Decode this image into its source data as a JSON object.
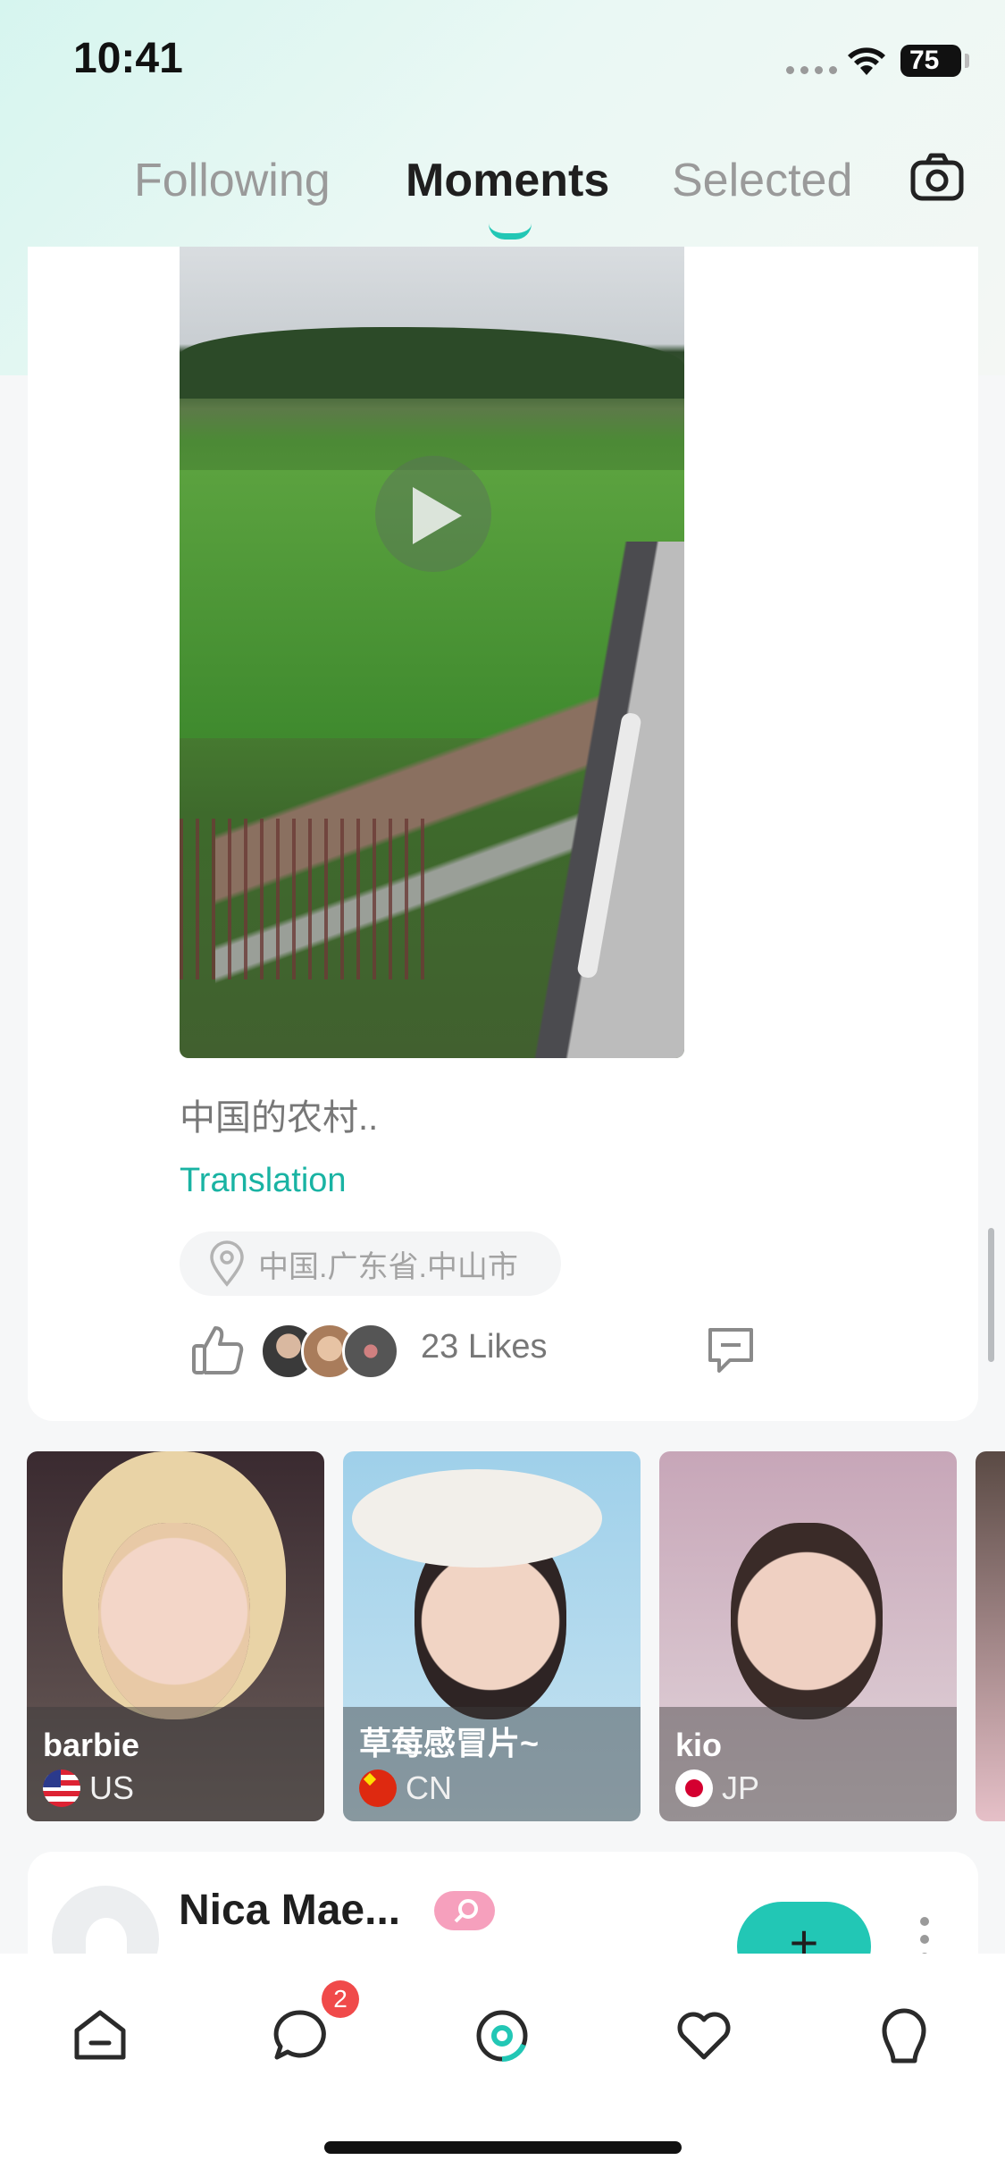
{
  "status_bar": {
    "time": "10:41",
    "battery": "75"
  },
  "tabs": [
    {
      "label": "Following",
      "active": false
    },
    {
      "label": "Moments",
      "active": true
    },
    {
      "label": "Selected",
      "active": false
    }
  ],
  "post": {
    "caption": "中国的农村..",
    "translation_label": "Translation",
    "location": "中国.广东省.中山市",
    "likes": "23 Likes"
  },
  "profiles": [
    {
      "name": "barbie",
      "country": "US"
    },
    {
      "name": "草莓感冒片~",
      "country": "CN"
    },
    {
      "name": "kio",
      "country": "JP"
    }
  ],
  "next_post": {
    "name": "Nica Mae...",
    "follow_label": "+"
  },
  "nav": {
    "items": [
      "home-icon",
      "chat-icon",
      "moments-icon",
      "heart-icon",
      "profile-icon"
    ],
    "chat_badge": "2"
  },
  "colors": {
    "accent": "#22c7b5",
    "badge": "#f04a4a",
    "translation": "#19b3a3"
  }
}
